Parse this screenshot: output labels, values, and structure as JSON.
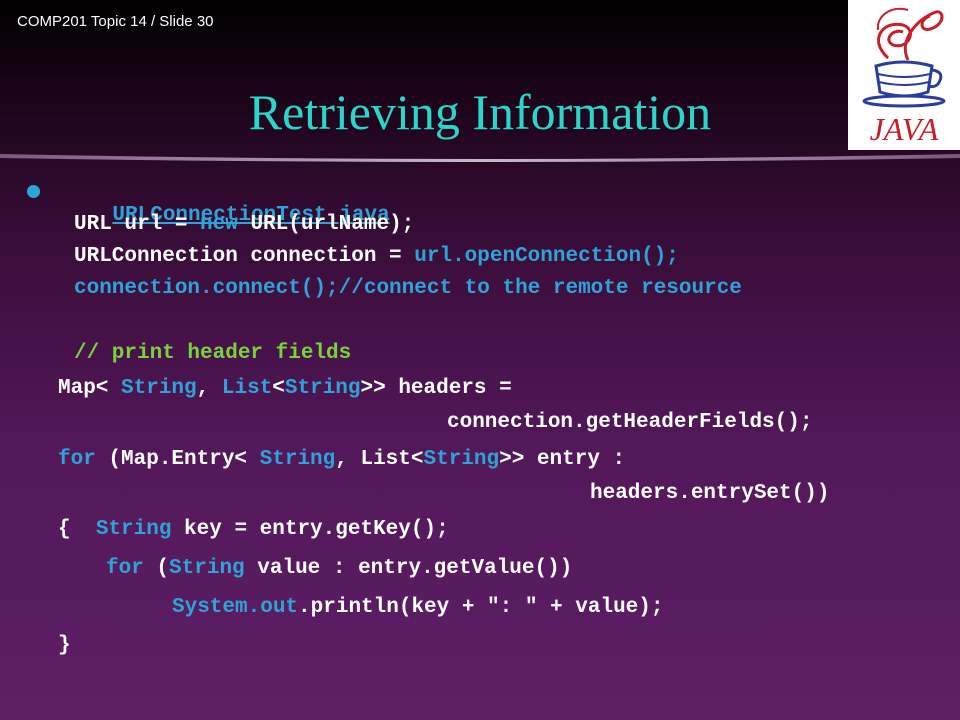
{
  "header": {
    "slide_number": "COMP201 Topic 14 / Slide 30"
  },
  "title": "Retrieving Information",
  "logo": {
    "name": "java-logo",
    "text": "JAVA"
  },
  "bullet": {
    "link_text": "URLConnectionTest.java"
  },
  "code": {
    "l1": {
      "a": "URL url = ",
      "b": "new",
      "c": " URL(urlName);"
    },
    "l2": {
      "a": "URLConnection connection = ",
      "b": "url.openConnection();"
    },
    "l3": {
      "a": "connection.connect();//connect to the remote resource"
    },
    "l4": {
      "a": "// print header fields"
    },
    "l5": {
      "a": "Map<",
      "b": " String",
      "c": ", ",
      "d": "List",
      "e": "<",
      "f": "String",
      "g": ">> headers ="
    },
    "l6": {
      "a": "connection.getHeaderFields();"
    },
    "l7": {
      "a": "for",
      "b": " (Map.Entry<",
      "c": " String",
      "d": ", List<",
      "e": "String",
      "f": ">> entry :"
    },
    "l8": {
      "a": "headers.entrySet())"
    },
    "l9": {
      "a": "{  ",
      "b": "String",
      "c": " key = entry.getKey();"
    },
    "l10": {
      "a": "for",
      "b": " (",
      "c": "String",
      "d": " value : entry.getValue())"
    },
    "l11": {
      "a": "System.out",
      "b": ".println(key + \": \" + value);"
    },
    "l12": {
      "a": "}"
    }
  },
  "colors": {
    "title": "#2ad6c8",
    "keyword": "#2ea3d6",
    "comment": "#79d23b",
    "text": "#ffffff"
  }
}
